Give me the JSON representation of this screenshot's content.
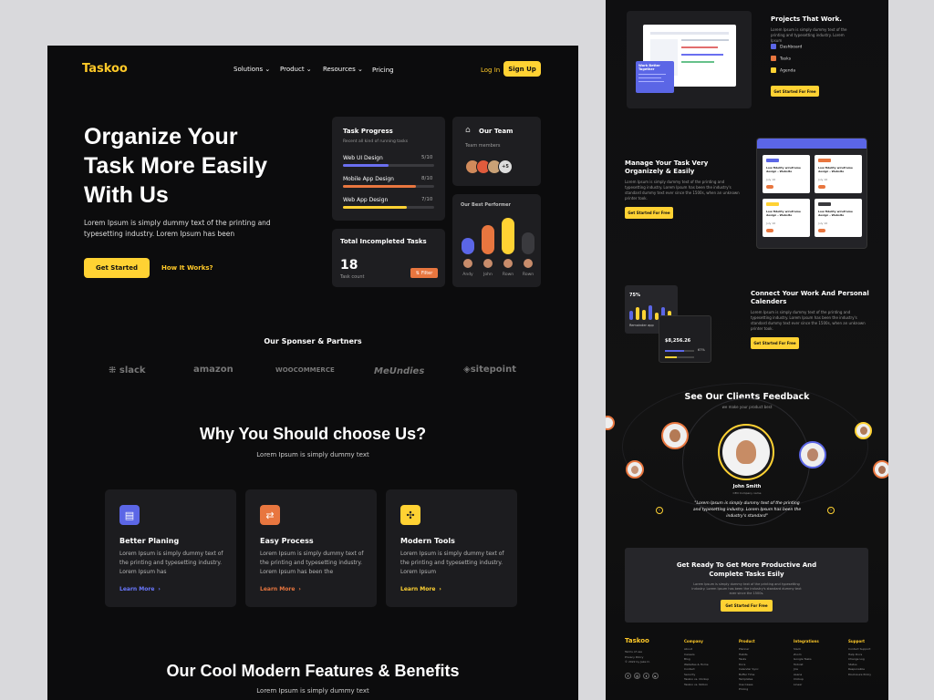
{
  "brand": {
    "name": "Taskoo"
  },
  "nav": {
    "items": [
      "Solutions",
      "Product",
      "Resources",
      "Pricing"
    ],
    "login": "Log In",
    "signup": "Sign Up"
  },
  "hero": {
    "line1": "Organize Your",
    "line2": "Task More Easily",
    "line3": "With Us",
    "desc": "Lorem Ipsum is simply dummy text of the printing and typesetting industry. Lorem Ipsum has been",
    "cta": "Get Started",
    "secondary": "How It Works?"
  },
  "task_progress": {
    "title": "Task Progress",
    "subtitle": "Recent all kind of running tasks",
    "items": [
      {
        "name": "Web UI Design",
        "count": "5/10",
        "progress": 0.5,
        "color": "#6a6ff0"
      },
      {
        "name": "Mobile App Design",
        "count": "8/10",
        "progress": 0.8,
        "color": "#e8763f"
      },
      {
        "name": "Web App Design",
        "count": "7/10",
        "progress": 0.7,
        "color": "#ffd233"
      }
    ]
  },
  "team": {
    "title": "Our Team",
    "subtitle": "Team members",
    "more": "+5"
  },
  "incomplete": {
    "title": "Total Incompleted Tasks",
    "count": "18",
    "label": "Task count",
    "filter": "Filter"
  },
  "performer": {
    "title": "Our Best Performer",
    "names": [
      "Andy",
      "John",
      "Rown",
      "Rown"
    ],
    "levels": [
      0.45,
      0.8,
      1.0,
      0.6
    ],
    "colors": [
      "#5b66e6",
      "#e8763f",
      "#ffd233",
      "#3a3a3e"
    ]
  },
  "sponsors": {
    "title": "Our Sponser & Partners",
    "logos": [
      "slack",
      "amazon",
      "WOOCOMMERCE",
      "MeUndies",
      "sitepoint"
    ]
  },
  "why": {
    "title": "Why You Should choose Us?",
    "subtitle": "Lorem Ipsum is simply dummy text",
    "features": [
      {
        "title": "Better Planing",
        "desc": "Lorem Ipsum is simply dummy text of the printing and typesetting industry. Lorem Ipsum has",
        "link": "Learn More",
        "color": "#5b66e6"
      },
      {
        "title": "Easy Process",
        "desc": "Lorem Ipsum is simply dummy text of the printing and typesetting industry. Lorem Ipsum has been the",
        "link": "Learn More",
        "color": "#e8763f"
      },
      {
        "title": "Modern Tools",
        "desc": "Lorem Ipsum is simply dummy text of the printing and typesetting industry. Lorem Ipsum",
        "link": "Learn More",
        "color": "#ffd233"
      }
    ]
  },
  "features_section": {
    "title": "Our Cool Modern Features & Benefits",
    "subtitle": "Lorem Ipsum is simply dummy text"
  },
  "right": {
    "projects": {
      "title": "Projects That Work.",
      "desc": "Lorem Ipsum is simply dummy text of the printing and typesetting industry. Lorem Ipsum",
      "items": [
        "Dashboard",
        "Tasks",
        "Agenda"
      ],
      "cta": "Get Started For Free",
      "badge": "Work Better Together"
    },
    "manage": {
      "title": "Manage Your Task Very Organizely & Easily",
      "desc": "Lorem Ipsum is simply dummy text of the printing and typesetting industry. Lorem Ipsum has been the industry's standard dummy text ever since the 1500s, when an unknown printer took.",
      "cta": "Get Started For Free",
      "card_text": "Low fidelity wireframe design - Website",
      "dates": [
        "July 16",
        "July 16",
        "July 16",
        "July 16"
      ]
    },
    "calendar": {
      "title": "Connect Your Work And Personal Calenders",
      "desc": "Lorem Ipsum is simply dummy text of the printing and typesetting industry. Lorem Ipsum has been the industry's standard dummy text ever since the 1500s, when an unknown printer took.",
      "cta": "Get Started For Free",
      "percent": "75%",
      "amount": "$8,256.26",
      "label": "Remainder app",
      "pct2": "67%"
    },
    "feedback": {
      "title": "See Our Clients Feedback",
      "subtitle": "we make your product best",
      "name": "John Smith",
      "role": "CEO Company name",
      "quote": "\"Lorem Ipsum is simply dummy text of the printing and typesetting industry. Lorem Ipsum has been the industry's standard\""
    },
    "cta_box": {
      "title": "Get Ready To Get More Productive And Complete Tasks Esily",
      "desc": "Lorem Ipsum is simply dummy text of the printing and typesetting industry. Lorem Ipsum has been the industry's standard dummy text ever since the 1500s.",
      "cta": "Get Started For Free"
    },
    "footer": {
      "brand": "Taskoo",
      "links": [
        "Terms of use",
        "Privacy Policy",
        "© 2022 by Jake D."
      ],
      "columns": [
        {
          "title": "Company",
          "items": [
            "About",
            "Careers",
            "Blog",
            "Websites & Home",
            "Contact",
            "Security",
            "Taskoo vs. Clickup",
            "Taskoo vs. Notion"
          ]
        },
        {
          "title": "Product",
          "items": [
            "Planner",
            "Habits",
            "Tasks",
            "Docs",
            "Calendar Sync",
            "Buffer Time",
            "Templates",
            "Use Cases",
            "Pricing"
          ]
        },
        {
          "title": "Integrations",
          "items": [
            "Slack",
            "Zoom",
            "Google Tasks",
            "Todoist",
            "Jira",
            "Asana",
            "Clickup",
            "Linear"
          ]
        },
        {
          "title": "Support",
          "items": [
            "Contact Support",
            "Help Docs",
            "Change Log",
            "Status",
            "Responsible",
            "Disclosure Policy"
          ]
        }
      ]
    }
  }
}
